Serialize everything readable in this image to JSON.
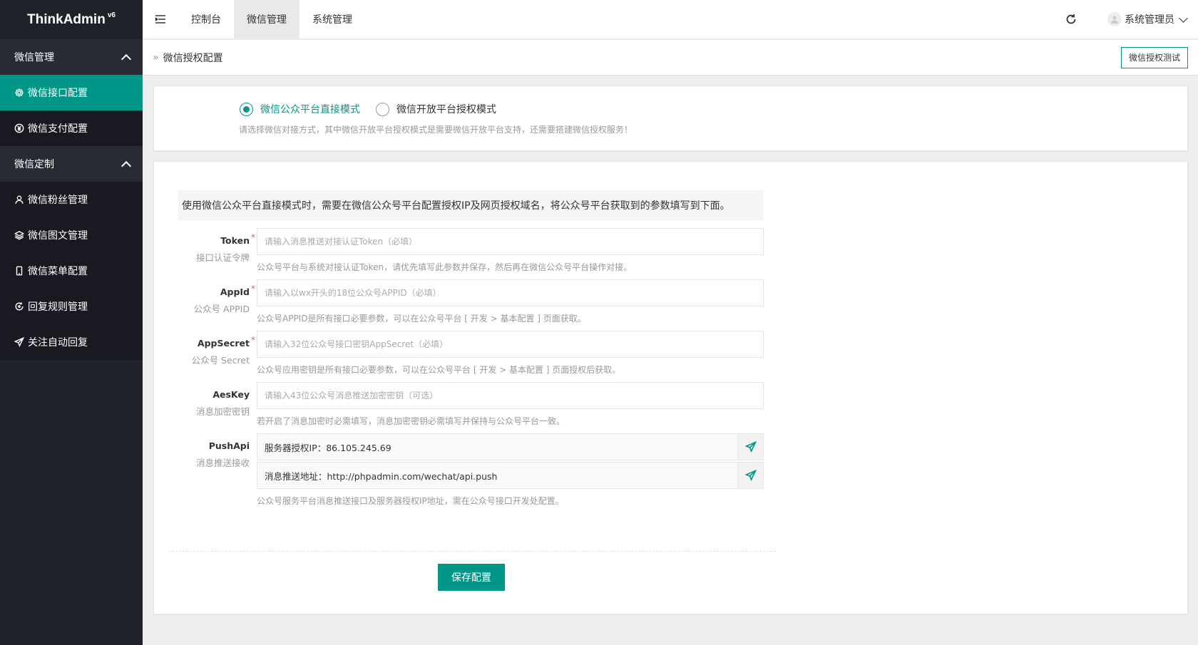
{
  "app": {
    "logo_text": "ThinkAdmin",
    "logo_version": "v6"
  },
  "sidebar": {
    "groups": [
      {
        "label": "微信管理",
        "items": [
          {
            "label": "微信接口配置",
            "icon": "gear-icon",
            "active": true
          },
          {
            "label": "微信支付配置",
            "icon": "yen-icon",
            "active": false
          }
        ]
      },
      {
        "label": "微信定制",
        "items": [
          {
            "label": "微信粉丝管理",
            "icon": "user-icon"
          },
          {
            "label": "微信图文管理",
            "icon": "layers-icon"
          },
          {
            "label": "微信菜单配置",
            "icon": "phone-icon"
          },
          {
            "label": "回复规则管理",
            "icon": "reply-icon"
          },
          {
            "label": "关注自动回复",
            "icon": "send-icon"
          }
        ]
      }
    ]
  },
  "header": {
    "tabs": [
      {
        "label": "控制台",
        "active": false
      },
      {
        "label": "微信管理",
        "active": true
      },
      {
        "label": "系统管理",
        "active": false
      }
    ],
    "user_name": "系统管理员"
  },
  "breadcrumb": {
    "title": "微信授权配置",
    "test_button": "微信授权测试"
  },
  "mode": {
    "options": [
      {
        "label": "微信公众平台直接模式",
        "checked": true
      },
      {
        "label": "微信开放平台授权模式",
        "checked": false
      }
    ],
    "hint": "请选择微信对接方式，其中微信开放平台授权模式是需要微信开放平台支持，还需要搭建微信授权服务！"
  },
  "form": {
    "intro": "使用微信公众平台直接模式时，需要在微信公众号平台配置授权IP及网页授权域名，将公众号平台获取到的参数填写到下面。",
    "fields": [
      {
        "key": "Token",
        "sub": "接口认证令牌",
        "required": "*",
        "placeholder": "请输入消息推送对接认证Token（必填）",
        "help": "公众号平台与系统对接认证Token，请优先填写此参数并保存，然后再在微信公众号平台操作对接。"
      },
      {
        "key": "AppId",
        "sub": "公众号 APPID",
        "required": "*",
        "placeholder": "请输入以wx开头的18位公众号APPID（必填）",
        "help": "公众号APPID是所有接口必要参数，可以在公众号平台 [ 开发 > 基本配置 ] 页面获取。"
      },
      {
        "key": "AppSecret",
        "sub": "公众号 Secret",
        "required": "*",
        "placeholder": "请输入32位公众号接口密钥AppSecret（必填）",
        "help": "公众号应用密钥是所有接口必要参数，可以在公众号平台 [ 开发 > 基本配置 ] 页面授权后获取。"
      },
      {
        "key": "AesKey",
        "sub": "消息加密密钥",
        "required": "",
        "placeholder": "请输入43位公众号消息推送加密密钥（可选）",
        "help": "若开启了消息加密时必需填写，消息加密密钥必需填写并保持与公众号平台一致。"
      }
    ],
    "push": {
      "key": "PushApi",
      "sub": "消息推送接收",
      "ip_text": "服务器授权IP：86.105.245.69",
      "url_text": "消息推送地址：http://phpadmin.com/wechat/api.push",
      "help": "公众号服务平台消息推送接口及服务器授权IP地址，需在公众号接口开发处配置。"
    },
    "save_button": "保存配置"
  },
  "colors": {
    "accent": "#009688",
    "sidebar_bg": "#20222a",
    "required": "#ff4d4f"
  }
}
